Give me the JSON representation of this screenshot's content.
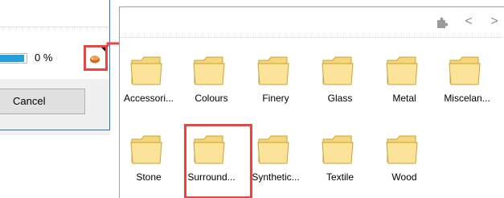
{
  "progress": {
    "percent_text": "0 %",
    "fill_fraction": 0.9
  },
  "dialog": {
    "cancel_label": "Cancel"
  },
  "browser": {
    "nav": {
      "back_symbol": "<",
      "forward_symbol": ">",
      "puzzle_icon": "puzzle-icon"
    },
    "folders": [
      {
        "label": "Accessori..."
      },
      {
        "label": "Colours"
      },
      {
        "label": "Finery"
      },
      {
        "label": "Glass"
      },
      {
        "label": "Metal"
      },
      {
        "label": "Miscelan..."
      },
      {
        "label": "Stone"
      },
      {
        "label": "Surround..."
      },
      {
        "label": "Synthetic..."
      },
      {
        "label": "Textile"
      },
      {
        "label": "Wood"
      }
    ]
  },
  "colors": {
    "highlight": "#e84545",
    "progress_fill": "#26a0da",
    "folder_body": "#f6d67a",
    "folder_edge": "#c9a233"
  }
}
